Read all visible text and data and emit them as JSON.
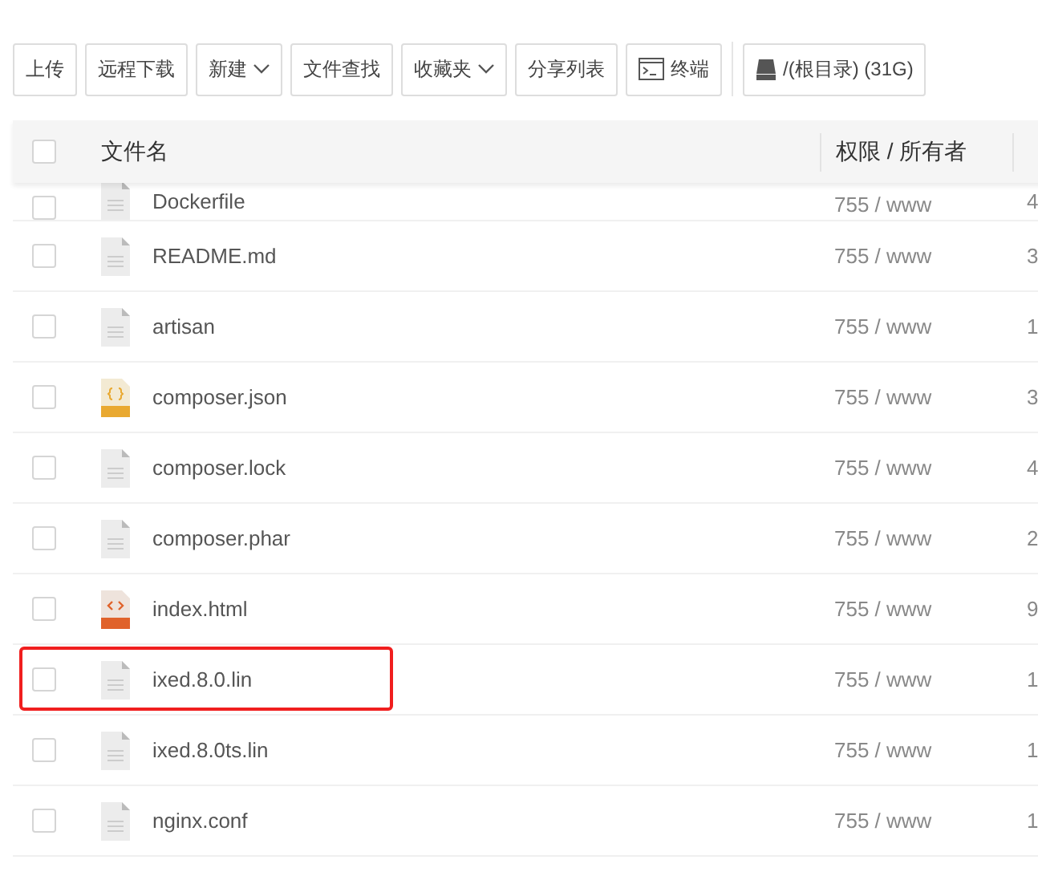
{
  "toolbar": {
    "buttons": [
      {
        "label": "上传",
        "kind": "plain"
      },
      {
        "label": "远程下载",
        "kind": "plain"
      },
      {
        "label": "新建",
        "kind": "dropdown"
      },
      {
        "label": "文件查找",
        "kind": "plain"
      },
      {
        "label": "收藏夹",
        "kind": "dropdown"
      },
      {
        "label": "分享列表",
        "kind": "plain"
      },
      {
        "label": "终端",
        "kind": "terminal"
      },
      {
        "label": "/(根目录) (31G)",
        "kind": "disk"
      }
    ]
  },
  "table": {
    "select_all_checked": false,
    "columns": [
      "文件名",
      "权限 / 所有者"
    ],
    "rows": [
      {
        "name": "Dockerfile",
        "kind": "file",
        "permission": "755 / www",
        "column_3": "4",
        "checked": false,
        "highlighted": false
      },
      {
        "name": "README.md",
        "kind": "file",
        "permission": "755 / www",
        "column_3": "3",
        "checked": false,
        "highlighted": false
      },
      {
        "name": "artisan",
        "kind": "file",
        "permission": "755 / www",
        "column_3": "1",
        "checked": false,
        "highlighted": false
      },
      {
        "name": "composer.json",
        "kind": "json",
        "permission": "755 / www",
        "column_3": "3",
        "checked": false,
        "highlighted": false
      },
      {
        "name": "composer.lock",
        "kind": "file",
        "permission": "755 / www",
        "column_3": "4",
        "checked": false,
        "highlighted": false
      },
      {
        "name": "composer.phar",
        "kind": "file",
        "permission": "755 / www",
        "column_3": "2",
        "checked": false,
        "highlighted": false
      },
      {
        "name": "index.html",
        "kind": "html",
        "permission": "755 / www",
        "column_3": "9",
        "checked": false,
        "highlighted": false
      },
      {
        "name": "ixed.8.0.lin",
        "kind": "file",
        "permission": "755 / www",
        "column_3": "1",
        "checked": false,
        "highlighted": true
      },
      {
        "name": "ixed.8.0ts.lin",
        "kind": "file",
        "permission": "755 / www",
        "column_3": "1",
        "checked": false,
        "highlighted": false
      },
      {
        "name": "nginx.conf",
        "kind": "file",
        "permission": "755 / www",
        "column_3": "1",
        "checked": false,
        "highlighted": false
      }
    ]
  }
}
